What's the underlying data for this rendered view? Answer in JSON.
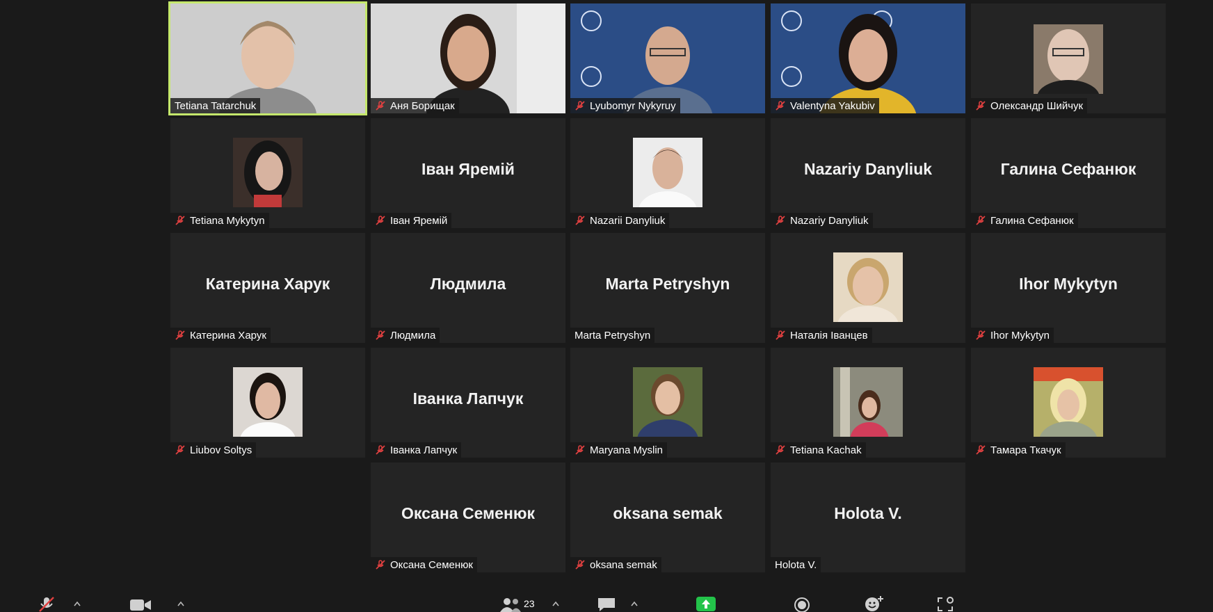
{
  "meeting": {
    "participant_count": "23"
  },
  "tiles": [
    {
      "id": "t1",
      "label": "Tetiana Tatarchuk",
      "muted": false,
      "kind": "video",
      "bg": "#cfcfcf",
      "active": true
    },
    {
      "id": "t2",
      "label": "Аня Борищак",
      "muted": true,
      "kind": "video",
      "bg": "#d6d6d6"
    },
    {
      "id": "t3",
      "label": "Lyubomyr Nykyruy",
      "muted": true,
      "kind": "video",
      "bg": "#2b4d86"
    },
    {
      "id": "t4",
      "label": "Valentyna Yakubiv",
      "muted": true,
      "kind": "video",
      "bg": "#2b4d86"
    },
    {
      "id": "t5",
      "label": "Олександр Шийчук",
      "muted": true,
      "kind": "photo",
      "bg": "#8a7a6a"
    },
    {
      "id": "t6",
      "label": "Tetiana Mykytyn",
      "muted": true,
      "kind": "photo",
      "bg": "#3b2f2a"
    },
    {
      "id": "t7",
      "label": "Іван Яремій",
      "muted": true,
      "kind": "name",
      "display": "Іван Яремій"
    },
    {
      "id": "t8",
      "label": "Nazarii Danyliuk",
      "muted": true,
      "kind": "photo",
      "bg": "#e9e9e9"
    },
    {
      "id": "t9",
      "label": "Nazariy Danyliuk",
      "muted": true,
      "kind": "name",
      "display": "Nazariy Danyliuk"
    },
    {
      "id": "t10",
      "label": "Галина Сефанюк",
      "muted": true,
      "kind": "name",
      "display": "Галина Сефанюк"
    },
    {
      "id": "t11",
      "label": "Катерина Харук",
      "muted": true,
      "kind": "name",
      "display": "Катерина Харук"
    },
    {
      "id": "t12",
      "label": "Людмила",
      "muted": true,
      "kind": "name",
      "display": "Людмила"
    },
    {
      "id": "t13",
      "label": "Marta Petryshyn",
      "muted": false,
      "kind": "name",
      "display": "Marta Petryshyn"
    },
    {
      "id": "t14",
      "label": "Наталія Іванцев",
      "muted": true,
      "kind": "photo",
      "bg": "#c9b48d"
    },
    {
      "id": "t15",
      "label": "Ihor Mykytyn",
      "muted": true,
      "kind": "name",
      "display": "Ihor Mykytyn"
    },
    {
      "id": "t16",
      "label": "Liubov Soltys",
      "muted": true,
      "kind": "photo",
      "bg": "#d9d4cf"
    },
    {
      "id": "t17",
      "label": "Іванка Лапчук",
      "muted": true,
      "kind": "name",
      "display": "Іванка Лапчук"
    },
    {
      "id": "t18",
      "label": "Maryana Myslin",
      "muted": true,
      "kind": "photo",
      "bg": "#5b6b3d"
    },
    {
      "id": "t19",
      "label": "Tetiana Kachak",
      "muted": true,
      "kind": "photo",
      "bg": "#8c8b7d"
    },
    {
      "id": "t20",
      "label": "Тамара Ткачук",
      "muted": true,
      "kind": "photo",
      "bg": "#b6b06a"
    },
    {
      "id": "t21",
      "label": "Оксана Семенюк",
      "muted": true,
      "kind": "name",
      "display": "Оксана Семенюк"
    },
    {
      "id": "t22",
      "label": "oksana semak",
      "muted": true,
      "kind": "name",
      "display": "oksana semak"
    },
    {
      "id": "t23",
      "label": "Holota V.",
      "muted": false,
      "kind": "name",
      "display": "Holota V."
    }
  ],
  "colors": {
    "active_border": "#c5e86c",
    "mute_red": "#e04040",
    "share_green": "#23c34a"
  },
  "toolbar_icons": [
    "mic-off-icon",
    "video-camera-icon",
    "participants-icon",
    "chat-icon",
    "share-screen-icon",
    "record-icon",
    "reactions-icon",
    "apps-icon"
  ]
}
